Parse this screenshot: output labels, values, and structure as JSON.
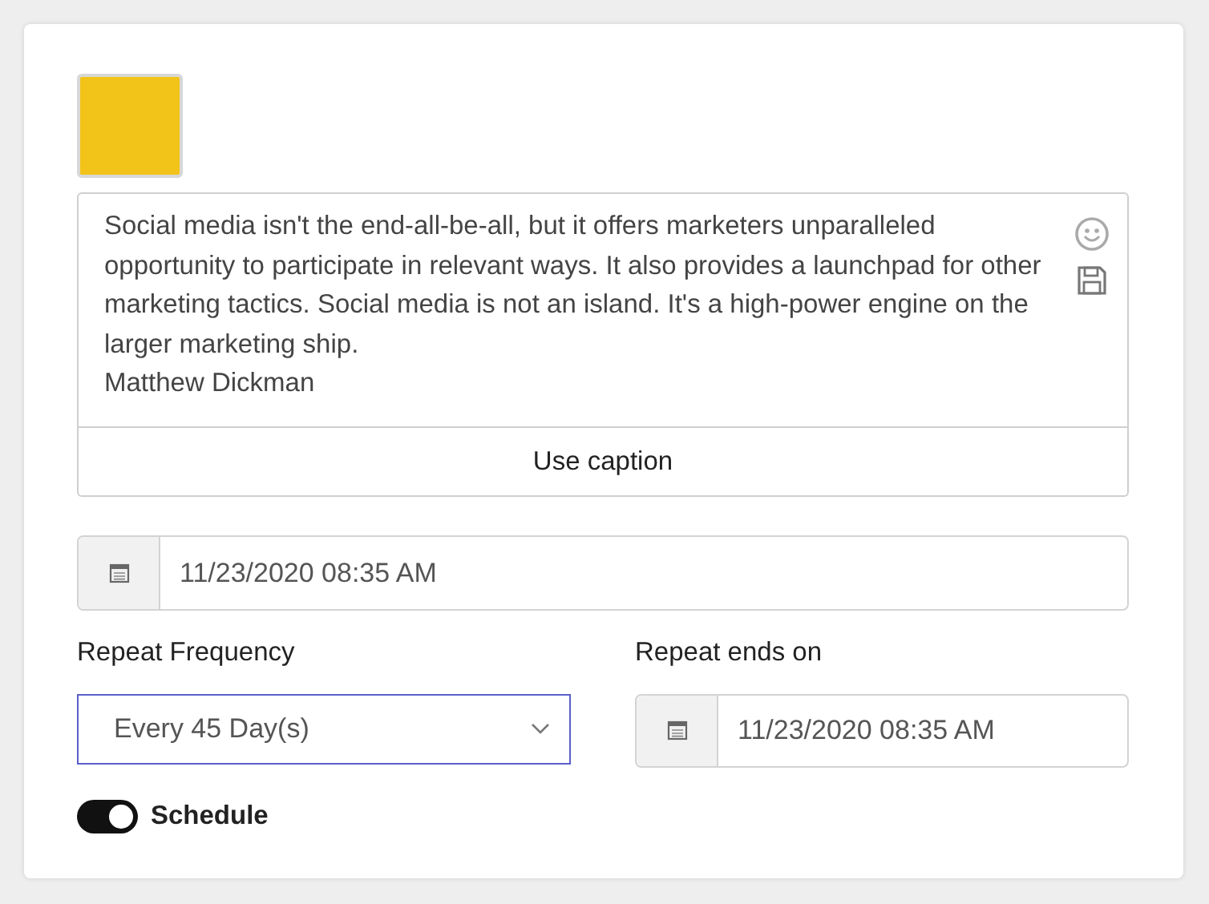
{
  "post": {
    "caption": "Social media isn't the end-all-be-all, but it offers marketers unparalleled opportunity to participate in relevant ways. It also provides a launchpad for other marketing tactics. Social media is not an island. It's a high-power engine on the larger marketing ship.\nMatthew Dickman",
    "use_caption_button": "Use caption"
  },
  "schedule_date": {
    "value": "11/23/2020 08:35 AM"
  },
  "repeat_frequency": {
    "label": "Repeat Frequency",
    "value": "Every 45 Day(s)"
  },
  "repeat_ends_on": {
    "label": "Repeat ends on",
    "value": "11/23/2020 08:35 AM"
  },
  "schedule_toggle": {
    "label": "Schedule",
    "on": true
  }
}
